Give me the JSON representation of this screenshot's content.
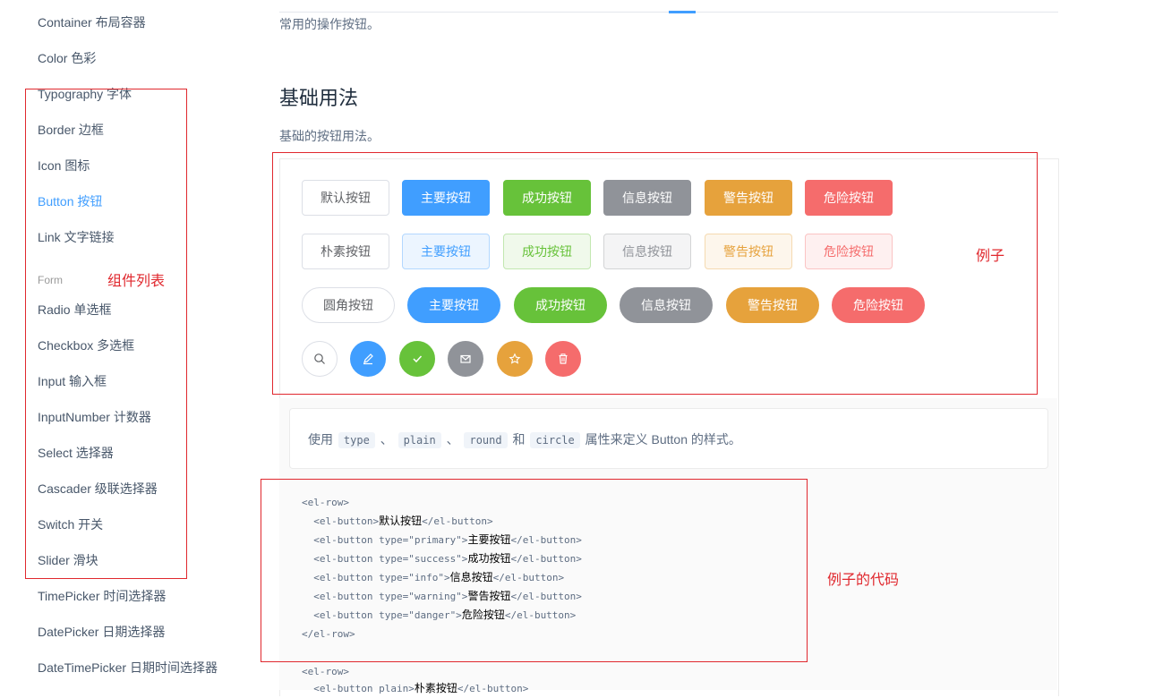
{
  "sidebar": {
    "items": [
      {
        "label": "Container 布局容器"
      },
      {
        "label": "Color 色彩"
      },
      {
        "label": "Typography 字体"
      },
      {
        "label": "Border 边框"
      },
      {
        "label": "Icon 图标"
      },
      {
        "label": "Button 按钮"
      },
      {
        "label": "Link 文字链接"
      },
      {
        "label": "Radio 单选框"
      },
      {
        "label": "Checkbox 多选框"
      },
      {
        "label": "Input 输入框"
      },
      {
        "label": "InputNumber 计数器"
      },
      {
        "label": "Select 选择器"
      },
      {
        "label": "Cascader 级联选择器"
      },
      {
        "label": "Switch 开关"
      },
      {
        "label": "Slider 滑块"
      },
      {
        "label": "TimePicker 时间选择器"
      },
      {
        "label": "DatePicker 日期选择器"
      },
      {
        "label": "DateTimePicker 日期时间选择器"
      }
    ],
    "group_form": "Form",
    "active_label": "Button 按钮"
  },
  "annotations": {
    "component_list": "组件列表",
    "example": "例子",
    "example_code": "例子的代码"
  },
  "main": {
    "intro": "常用的操作按钮。",
    "section_title": "基础用法",
    "section_desc": "基础的按钮用法。",
    "row1": [
      "默认按钮",
      "主要按钮",
      "成功按钮",
      "信息按钮",
      "警告按钮",
      "危险按钮"
    ],
    "row2": [
      "朴素按钮",
      "主要按钮",
      "成功按钮",
      "信息按钮",
      "警告按钮",
      "危险按钮"
    ],
    "row3": [
      "圆角按钮",
      "主要按钮",
      "成功按钮",
      "信息按钮",
      "警告按钮",
      "危险按钮"
    ],
    "row4_icons": [
      "search-icon",
      "edit-icon",
      "check-icon",
      "message-icon",
      "star-icon",
      "delete-icon"
    ],
    "desc_card": {
      "prefix": "使用",
      "tag1": "type",
      "sep1": "、",
      "tag2": "plain",
      "sep2": "、",
      "tag3": "round",
      "and": "和",
      "tag4": "circle",
      "suffix": "属性来定义 Button 的样式。"
    },
    "code_lines": [
      {
        "open": "<el-row>",
        "text": "",
        "close": ""
      },
      {
        "open": "  <el-button>",
        "text": "默认按钮",
        "close": "</el-button>"
      },
      {
        "open": "  <el-button type=\"primary\">",
        "text": "主要按钮",
        "close": "</el-button>"
      },
      {
        "open": "  <el-button type=\"success\">",
        "text": "成功按钮",
        "close": "</el-button>"
      },
      {
        "open": "  <el-button type=\"info\">",
        "text": "信息按钮",
        "close": "</el-button>"
      },
      {
        "open": "  <el-button type=\"warning\">",
        "text": "警告按钮",
        "close": "</el-button>"
      },
      {
        "open": "  <el-button type=\"danger\">",
        "text": "危险按钮",
        "close": "</el-button>"
      },
      {
        "open": "</el-row>",
        "text": "",
        "close": ""
      }
    ],
    "code_line_next": {
      "open": "<el-row>",
      "text": "",
      "close": ""
    },
    "code_line_partial": {
      "open": "  <el-button plain>",
      "text": "朴素按钮",
      "close": "</el-button>"
    }
  },
  "colors": {
    "primary": "#409eff",
    "success": "#67c23a",
    "info": "#909399",
    "warning": "#e6a23c",
    "danger": "#f56c6c",
    "annotation_red": "#e0282e"
  }
}
